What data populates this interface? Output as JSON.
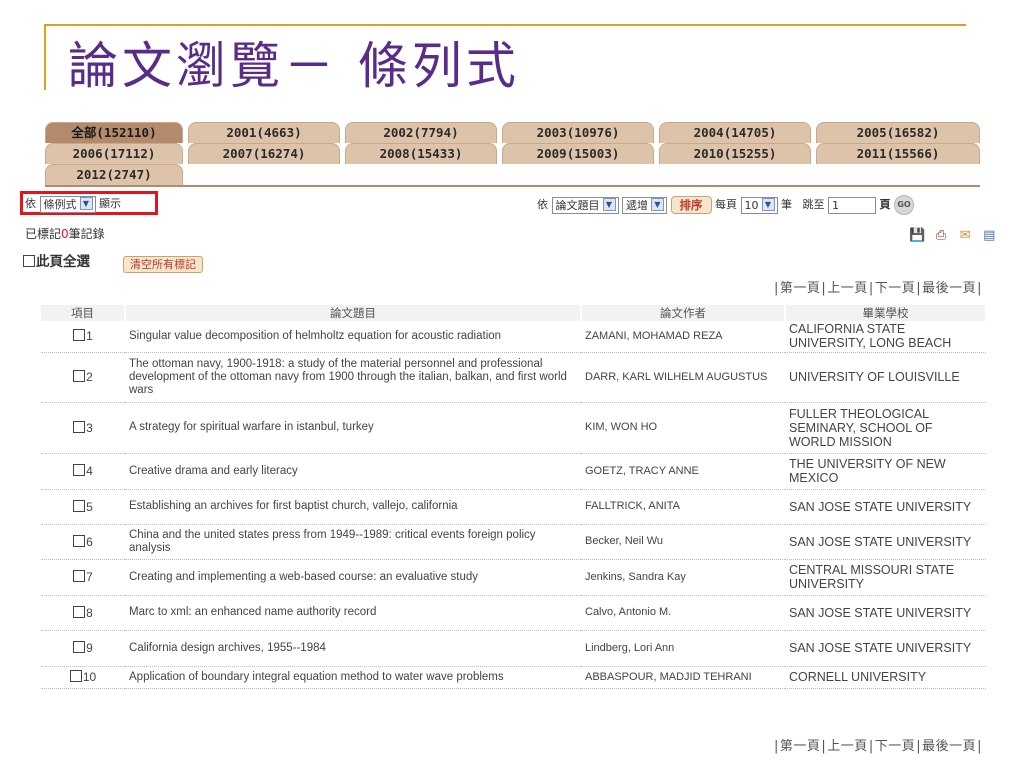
{
  "slide": {
    "title": "論文瀏覽－ 條列式"
  },
  "tabs": [
    {
      "label": "全部(152110)",
      "active": true
    },
    {
      "label": "2001(4663)"
    },
    {
      "label": "2002(7794)"
    },
    {
      "label": "2003(10976)"
    },
    {
      "label": "2004(14705)"
    },
    {
      "label": "2005(16582)"
    },
    {
      "label": "2006(17112)"
    },
    {
      "label": "2007(16274)"
    },
    {
      "label": "2008(15433)"
    },
    {
      "label": "2009(15003)"
    },
    {
      "label": "2010(15255)"
    },
    {
      "label": "2011(15566)"
    },
    {
      "label": "2012(2747)"
    }
  ],
  "display": {
    "prefix": "依",
    "mode": "條例式",
    "suffix": "顯示"
  },
  "sort": {
    "prefix": "依",
    "field": "論文題目",
    "order": "遞增",
    "button": "排序",
    "per_page_label": "每頁",
    "per_page": "10",
    "unit": "筆",
    "jump_label": "跳至",
    "jump_value": "1",
    "page_label": "頁",
    "go": "GO"
  },
  "marked": {
    "prefix": "已標記",
    "count": "0",
    "suffix": "筆記錄"
  },
  "icons": [
    "save-icon",
    "print-icon",
    "mail-icon",
    "export-icon"
  ],
  "select_all_label": "此頁全選",
  "clear_button": "清空所有標記",
  "pager": {
    "first": "第一頁",
    "prev": "上一頁",
    "next": "下一頁",
    "last": "最後一頁"
  },
  "table": {
    "headers": [
      "項目",
      "論文題目",
      "論文作者",
      "畢業學校"
    ],
    "rows": [
      {
        "no": "1",
        "title": "Singular value decomposition of helmholtz equation for acoustic radiation",
        "author": "ZAMANI, MOHAMAD REZA",
        "school": "CALIFORNIA STATE UNIVERSITY, LONG BEACH"
      },
      {
        "no": "2",
        "title": "The ottoman navy, 1900-1918: a study of the material personnel and professional development of the ottoman navy from 1900 through the italian, balkan, and first world wars",
        "author": "DARR, KARL WILHELM AUGUSTUS",
        "school": "UNIVERSITY OF LOUISVILLE"
      },
      {
        "no": "3",
        "title": "A strategy for spiritual warfare in istanbul, turkey",
        "author": "KIM, WON HO",
        "school": "FULLER THEOLOGICAL SEMINARY, SCHOOL OF WORLD MISSION"
      },
      {
        "no": "4",
        "title": "Creative drama and early literacy",
        "author": "GOETZ, TRACY ANNE",
        "school": "THE UNIVERSITY OF NEW MEXICO"
      },
      {
        "no": "5",
        "title": "Establishing an archives for first baptist church, vallejo, california",
        "author": "FALLTRICK, ANITA",
        "school": "SAN JOSE STATE UNIVERSITY"
      },
      {
        "no": "6",
        "title": "China and the united states press from 1949--1989: critical events foreign policy analysis",
        "author": "Becker, Neil Wu",
        "school": "SAN JOSE STATE UNIVERSITY"
      },
      {
        "no": "7",
        "title": "Creating and implementing a web-based course: an evaluative study",
        "author": "Jenkins, Sandra Kay",
        "school": "CENTRAL MISSOURI STATE UNIVERSITY"
      },
      {
        "no": "8",
        "title": "Marc to xml: an enhanced name authority record",
        "author": "Calvo, Antonio M.",
        "school": "SAN JOSE STATE UNIVERSITY"
      },
      {
        "no": "9",
        "title": "California design archives, 1955--1984",
        "author": "Lindberg, Lori Ann",
        "school": "SAN JOSE STATE UNIVERSITY"
      },
      {
        "no": "10",
        "title": "Application of boundary integral equation method to water wave problems",
        "author": "ABBASPOUR, MADJID TEHRANI",
        "school": "CORNELL UNIVERSITY"
      }
    ]
  }
}
